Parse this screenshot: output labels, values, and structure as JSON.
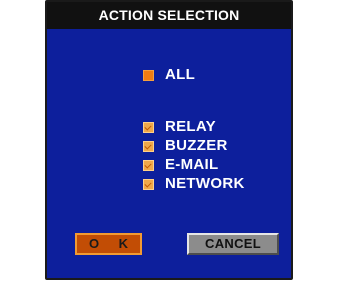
{
  "dialog": {
    "title": "ACTION SELECTION"
  },
  "options": {
    "all": {
      "label": "ALL"
    },
    "relay": {
      "label": "RELAY",
      "checked": true
    },
    "buzzer": {
      "label": "BUZZER",
      "checked": true
    },
    "email": {
      "label": "E-MAIL",
      "checked": true
    },
    "network": {
      "label": "NETWORK",
      "checked": true
    }
  },
  "buttons": {
    "ok_label": "O K",
    "cancel_label": "CANCEL"
  },
  "colors": {
    "background": "#0d1f9c",
    "title_bar": "#111111",
    "accent_orange": "#f07c12",
    "ok_button": "#c24d05",
    "cancel_button": "#8c8c8c"
  }
}
